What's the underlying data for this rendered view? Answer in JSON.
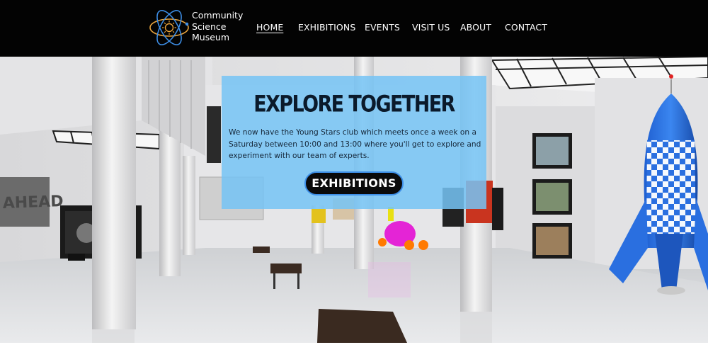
{
  "site": {
    "logo_lines": [
      "Community",
      "Science",
      "Museum"
    ],
    "logo_icon": "atom-icon"
  },
  "nav": {
    "items": [
      {
        "label": "HOME",
        "active": true
      },
      {
        "label": "EXHIBITIONS",
        "active": false
      },
      {
        "label": "EVENTS",
        "active": false
      },
      {
        "label": "VISIT US",
        "active": false
      },
      {
        "label": "ABOUT",
        "active": false
      },
      {
        "label": "CONTACT",
        "active": false
      }
    ]
  },
  "hero": {
    "title": "EXPLORE TOGETHER",
    "body": "We now have the Young Stars club which meets once a week on a Saturday between 10:00 and 13:00 where you'll get to explore and experiment with our team of experts.",
    "cta_label": "EXHIBITIONS",
    "background": "3D museum gallery interior with white columns, benches, framed pictures and a blue and white checkered rocket"
  },
  "colors": {
    "header_bg": "#030303",
    "panel_bg": "#76c4f4",
    "button_bg": "#0a0a0a",
    "button_border": "#3d8ee6",
    "logo_accent_blue": "#3d8ee6",
    "logo_accent_orange": "#e8a33c"
  }
}
